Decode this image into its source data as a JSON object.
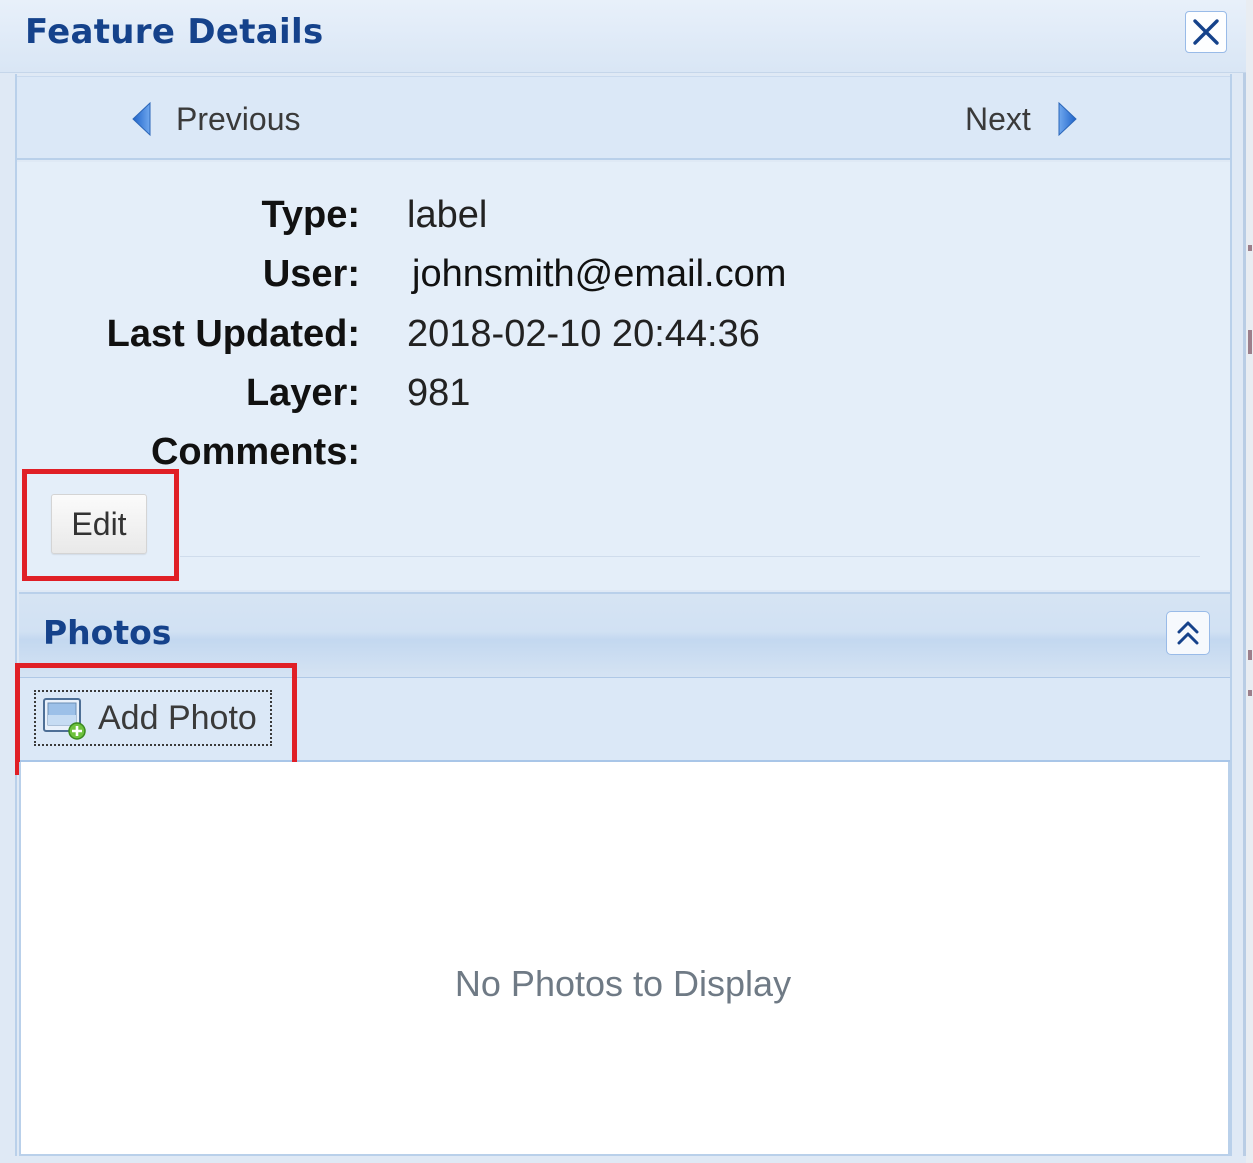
{
  "window": {
    "title": "Feature Details",
    "close_icon": "close-icon"
  },
  "navigation": {
    "previous_label": "Previous",
    "next_label": "Next",
    "previous_icon": "triangle-left-icon",
    "next_icon": "triangle-right-icon"
  },
  "details": {
    "type_label": "Type:",
    "type_value": "label",
    "user_label": "User:",
    "user_value": "johnsmith@email.com",
    "updated_label": "Last Updated:",
    "updated_value": "2018-02-10 20:44:36",
    "layer_label": "Layer:",
    "layer_value": "981",
    "comments_label": "Comments:",
    "comments_value": ""
  },
  "actions": {
    "edit_label": "Edit"
  },
  "photos": {
    "section_title": "Photos",
    "collapse_icon": "double-chevron-up-icon",
    "add_photo_label": "Add Photo",
    "add_photo_icon": "add-image-icon",
    "empty_message": "No Photos to Display"
  },
  "colors": {
    "title_blue": "#15428b",
    "highlight_red": "#e01f26",
    "nav_arrow_blue": "#3b7dd8"
  }
}
